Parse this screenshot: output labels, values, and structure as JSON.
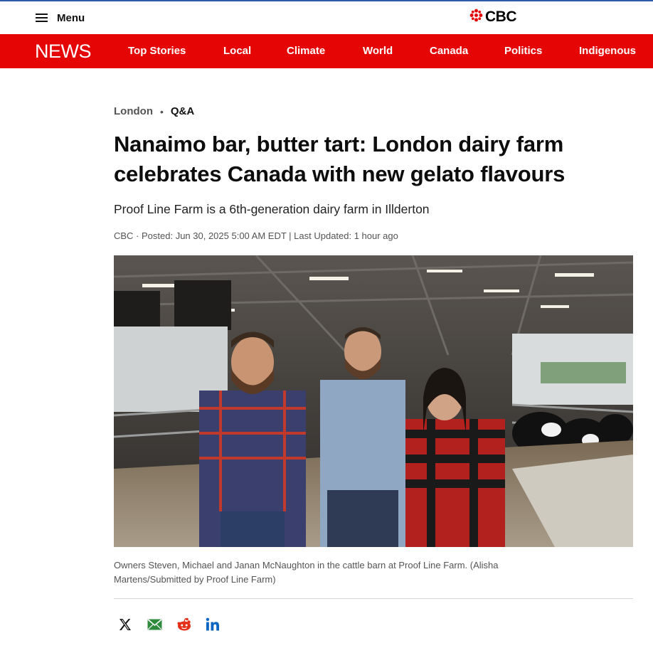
{
  "header": {
    "menu_label": "Menu",
    "brand": "CBC"
  },
  "newsbar": {
    "logo": "NEWS",
    "nav": [
      "Top Stories",
      "Local",
      "Climate",
      "World",
      "Canada",
      "Politics",
      "Indigenous"
    ]
  },
  "article": {
    "section": "London",
    "type": "Q&A",
    "title": "Nanaimo bar, butter tart: London dairy farm celebrates Canada with new gelato flavours",
    "subtitle": "Proof Line Farm is a 6th-generation dairy farm in Illderton",
    "byline": "CBC · Posted: Jun 30, 2025 5:00 AM EDT | Last Updated: 1 hour ago",
    "image_caption": "Owners Steven, Michael and Janan McNaughton in the cattle barn at Proof Line Farm. (Alisha Martens/Submitted by Proof Line Farm)"
  },
  "share": {
    "icons": [
      "x-icon",
      "email-icon",
      "reddit-icon",
      "linkedin-icon"
    ]
  },
  "colors": {
    "news_red": "#e60505",
    "top_border_blue": "#2b5da8",
    "text_grey": "#545454"
  }
}
